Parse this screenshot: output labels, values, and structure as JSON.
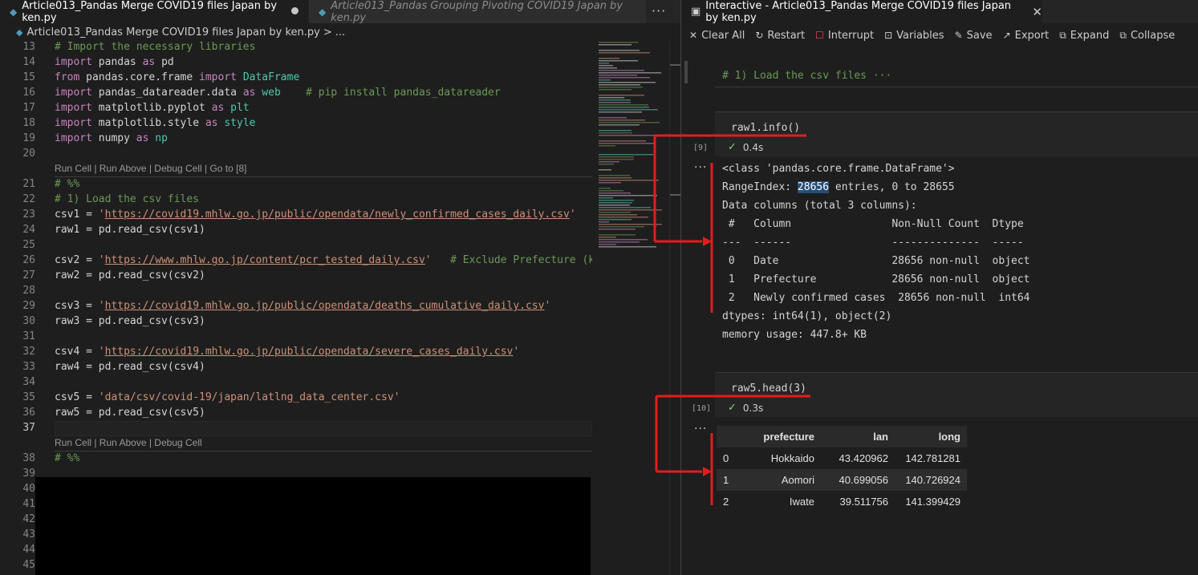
{
  "left_editor": {
    "tabs": [
      {
        "label": "Article013_Pandas Merge COVID19 files Japan by ken.py",
        "active": true,
        "modified": true
      },
      {
        "label": "Article013_Pandas Grouping Pivoting COVID19 Japan by ken.py",
        "active": false
      }
    ],
    "more_actions_glyph": "···",
    "breadcrumb": {
      "file": "Article013_Pandas Merge COVID19 files Japan by ken.py",
      "separator": ">",
      "ellipsis": "..."
    },
    "codelens": {
      "top": "Run Cell | Run Above | Debug Cell | Go to [8]",
      "bottom": "Run Cell | Run Above | Debug Cell"
    },
    "line_numbers": [
      "13",
      "14",
      "15",
      "16",
      "17",
      "18",
      "19",
      "20",
      "21",
      "22",
      "23",
      "24",
      "25",
      "26",
      "27",
      "28",
      "29",
      "30",
      "31",
      "32",
      "33",
      "34",
      "35",
      "36",
      "37",
      "38",
      "39",
      "40",
      "41",
      "42",
      "43",
      "44",
      "45"
    ],
    "code": {
      "l13": "# Import the necessary libraries",
      "l14_kw1": "import",
      "l14_mod": " pandas ",
      "l14_kw2": "as",
      "l14_alias": " pd",
      "l15_kw1": "from",
      "l15_mod": " pandas.core.frame ",
      "l15_kw2": "import",
      "l15_cls": " DataFrame",
      "l16_kw1": "import",
      "l16_mod": " pandas_datareader.data ",
      "l16_kw2": "as",
      "l16_alias": " web",
      "l16_cm": "    # pip install pandas_datareader",
      "l17_kw1": "import",
      "l17_mod": " matplotlib.pyplot ",
      "l17_kw2": "as",
      "l17_alias": " plt",
      "l18_kw1": "import",
      "l18_mod": " matplotlib.style ",
      "l18_kw2": "as",
      "l18_alias": " style",
      "l19_kw1": "import",
      "l19_mod": " numpy ",
      "l19_kw2": "as",
      "l19_alias": " np",
      "l21": "# %%",
      "l22": "# 1) Load the csv files",
      "l23_pre": "csv1 = ",
      "l23_q1": "'",
      "l23_url": "https://covid19.mhlw.go.jp/public/opendata/newly_confirmed_cases_daily.csv",
      "l23_q2": "'",
      "l24": "raw1 = pd.read_csv(csv1)",
      "l26_pre": "csv2 = ",
      "l26_q1": "'",
      "l26_url": "https://www.mhlw.go.jp/content/pcr_tested_daily.csv",
      "l26_q2": "'",
      "l26_cm": "   # Exclude Prefecture (ke",
      "l27": "raw2 = pd.read_csv(csv2)",
      "l29_pre": "csv3 = ",
      "l29_q1": "'",
      "l29_url": "https://covid19.mhlw.go.jp/public/opendata/deaths_cumulative_daily.csv",
      "l29_q2": "'",
      "l30": "raw3 = pd.read_csv(csv3)",
      "l32_pre": "csv4 = ",
      "l32_q1": "'",
      "l32_url": "https://covid19.mhlw.go.jp/public/opendata/severe_cases_daily.csv",
      "l32_q2": "'",
      "l33": "raw4 = pd.read_csv(csv4)",
      "l35_pre": "csv5 = ",
      "l35_str": "'data/csv/covid-19/japan/latlng_data_center.csv'",
      "l36": "raw5 = pd.read_csv(csv5)",
      "l38": "# %%"
    }
  },
  "interactive": {
    "tab_title": "Interactive - Article013_Pandas Merge COVID19 files Japan by ken.py",
    "toolbar": {
      "clear_all": "Clear All",
      "restart": "Restart",
      "interrupt": "Interrupt",
      "variables": "Variables",
      "save": "Save",
      "export": "Export",
      "expand": "Expand",
      "collapse": "Collapse"
    },
    "collapsed_cell": "# 1) Load the csv files ···",
    "cell9": {
      "code": "raw1.info()",
      "exec_count": "[9]",
      "duration": "0.4s",
      "output": {
        "line1": "<class 'pandas.core.frame.DataFrame'>",
        "range_pre": "RangeIndex: ",
        "range_val": "28656",
        "range_post": " entries, 0 to 28655",
        "line3": "Data columns (total 3 columns):",
        "line4": " #   Column                Non-Null Count  Dtype ",
        "line5": "---  ------                --------------  ----- ",
        "line6": " 0   Date                  28656 non-null  object",
        "line7": " 1   Prefecture            28656 non-null  object",
        "line8": " 2   Newly confirmed cases  28656 non-null  int64 ",
        "line9": "dtypes: int64(1), object(2)",
        "line10": "memory usage: 447.8+ KB"
      }
    },
    "cell10": {
      "code": "raw5.head(3)",
      "exec_count": "[10]",
      "duration": "0.3s",
      "table": {
        "columns": [
          "",
          "prefecture",
          "lan",
          "long"
        ],
        "rows": [
          [
            "0",
            "Hokkaido",
            "43.420962",
            "142.781281"
          ],
          [
            "1",
            "Aomori",
            "40.699056",
            "140.726924"
          ],
          [
            "2",
            "Iwate",
            "39.511756",
            "141.399429"
          ]
        ]
      }
    },
    "output_dots": "···"
  },
  "colors": {
    "annotation_red": "#e51c1c",
    "keyword": "#c586c0",
    "comment": "#6a9955",
    "string": "#ce9178",
    "class": "#4ec9b0",
    "highlight": "#264f78"
  }
}
